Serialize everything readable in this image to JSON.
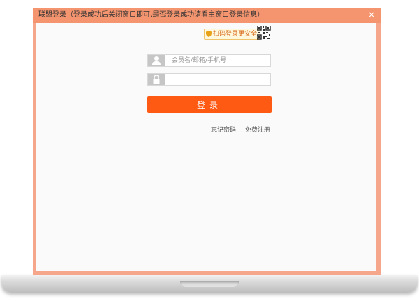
{
  "window": {
    "title": "联盟登录（登录成功后关闭窗口即可,是否登录成功请看主窗口登录信息）",
    "close_glyph": "×"
  },
  "qr_tip": {
    "label": "扫码登录更安全"
  },
  "username": {
    "placeholder": "会员名/邮箱/手机号",
    "value": ""
  },
  "password": {
    "placeholder": "",
    "value": ""
  },
  "login_button": {
    "label": "登录"
  },
  "links": {
    "forgot_password": "忘记密码",
    "register": "免费注册"
  },
  "colors": {
    "frame": "#f6a78b",
    "titlebar": "#f4956f",
    "login_button": "#ff5a14",
    "qr_tip_text": "#d86b1c"
  }
}
